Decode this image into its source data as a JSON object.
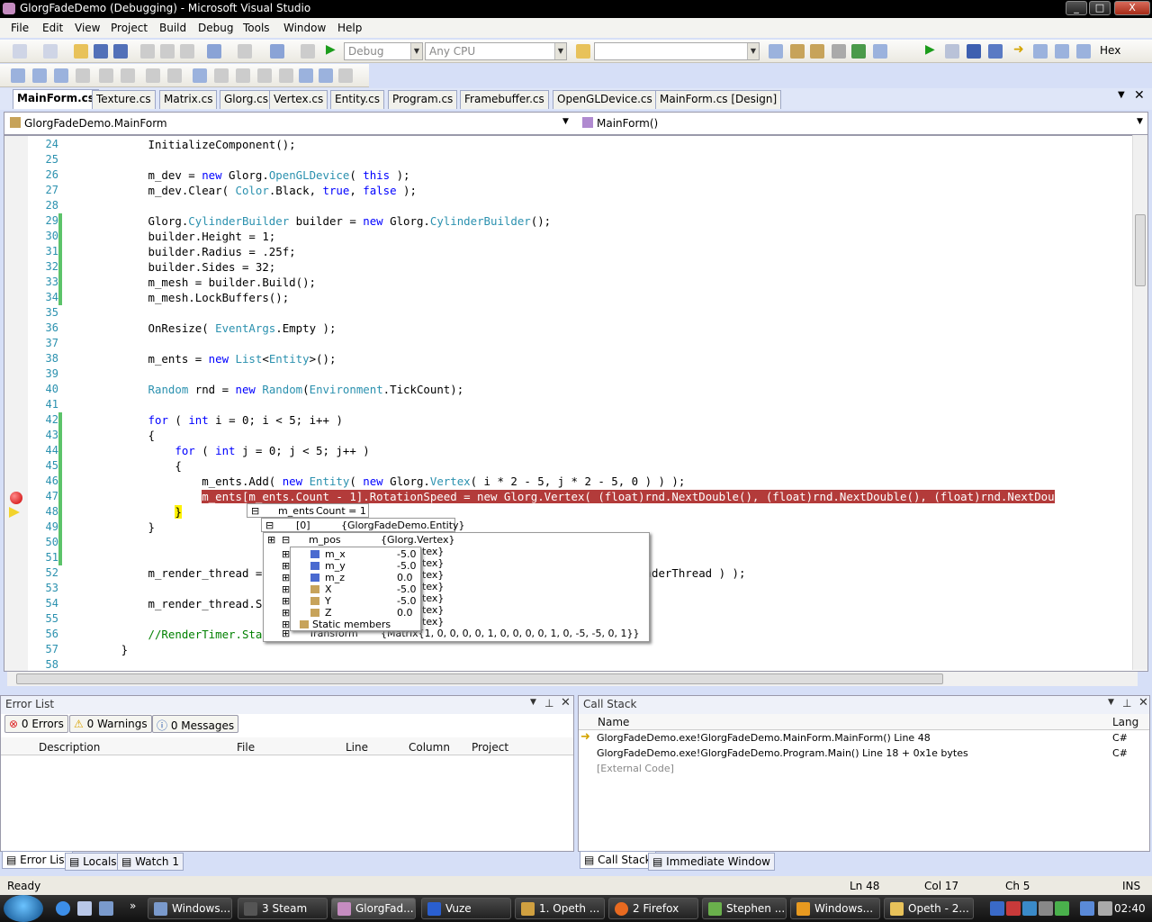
{
  "window": {
    "title": "GlorgFadeDemo (Debugging) - Microsoft Visual Studio",
    "minimize": "_",
    "maximize": "□",
    "close": "X"
  },
  "menu": [
    "File",
    "Edit",
    "View",
    "Project",
    "Build",
    "Debug",
    "Tools",
    "Window",
    "Help"
  ],
  "toolbar": {
    "config": "Debug",
    "platform": "Any CPU",
    "hex": "Hex"
  },
  "tabs": [
    "MainForm.cs",
    "Texture.cs",
    "Matrix.cs",
    "Glorg.cs",
    "Vertex.cs",
    "Entity.cs",
    "Program.cs",
    "Framebuffer.cs",
    "OpenGLDevice.cs",
    "MainForm.cs [Design]"
  ],
  "nav": {
    "class": "GlorgFadeDemo.MainForm",
    "member": "MainForm()"
  },
  "code": [
    {
      "n": "24",
      "t": "            InitializeComponent();"
    },
    {
      "n": "25",
      "t": ""
    },
    {
      "n": "26",
      "t": "            m_dev = new Glorg.OpenGLDevice( this );"
    },
    {
      "n": "27",
      "t": "            m_dev.Clear( Color.Black, true, false );"
    },
    {
      "n": "28",
      "t": ""
    },
    {
      "n": "29",
      "t": "            Glorg.CylinderBuilder builder = new Glorg.CylinderBuilder();"
    },
    {
      "n": "30",
      "t": "            builder.Height = 1;"
    },
    {
      "n": "31",
      "t": "            builder.Radius = .25f;"
    },
    {
      "n": "32",
      "t": "            builder.Sides = 32;"
    },
    {
      "n": "33",
      "t": "            m_mesh = builder.Build();"
    },
    {
      "n": "34",
      "t": "            m_mesh.LockBuffers();"
    },
    {
      "n": "35",
      "t": ""
    },
    {
      "n": "36",
      "t": "            OnResize( EventArgs.Empty );"
    },
    {
      "n": "37",
      "t": ""
    },
    {
      "n": "38",
      "t": "            m_ents = new List<Entity>();"
    },
    {
      "n": "39",
      "t": ""
    },
    {
      "n": "40",
      "t": "            Random rnd = new Random(Environment.TickCount);"
    },
    {
      "n": "41",
      "t": ""
    },
    {
      "n": "42",
      "t": "            for ( int i = 0; i < 5; i++ )"
    },
    {
      "n": "43",
      "t": "            {"
    },
    {
      "n": "44",
      "t": "                for ( int j = 0; j < 5; j++ )"
    },
    {
      "n": "45",
      "t": "                {"
    },
    {
      "n": "46",
      "t": "                    m_ents.Add( new Entity( new Glorg.Vertex( i * 2 - 5, j * 2 - 5, 0 ) ) );"
    },
    {
      "n": "47",
      "t": "                    m_ents[m_ents.Count - 1].RotationSpeed = new Glorg.Vertex( (float)rnd.NextDouble(), (float)rnd.NextDouble(), (float)rnd.NextDou"
    },
    {
      "n": "48",
      "t": "                }"
    },
    {
      "n": "49",
      "t": "            }"
    },
    {
      "n": "50",
      "t": ""
    },
    {
      "n": "51",
      "t": ""
    },
    {
      "n": "52",
      "t": "            m_render_thread =                                          ThreadStart( RenderThread ) );"
    },
    {
      "n": "53",
      "t": ""
    },
    {
      "n": "54",
      "t": "            m_render_thread.S"
    },
    {
      "n": "55",
      "t": ""
    },
    {
      "n": "56",
      "t": "            //RenderTimer.Sta"
    },
    {
      "n": "57",
      "t": "        }"
    },
    {
      "n": "58",
      "t": ""
    }
  ],
  "datatip": {
    "root": {
      "name": "m_ents",
      "value": "Count = 1"
    },
    "item": {
      "name": "[0]",
      "value": "{GlorgFadeDemo.Entity}"
    },
    "pos": {
      "name": "m_pos",
      "value": "{Glorg.Vertex}"
    },
    "fields": [
      {
        "name": "m_x",
        "value": "-5.0"
      },
      {
        "name": "m_y",
        "value": "-5.0"
      },
      {
        "name": "m_z",
        "value": "0.0"
      },
      {
        "name": "X",
        "value": "-5.0"
      },
      {
        "name": "Y",
        "value": "-5.0"
      },
      {
        "name": "Z",
        "value": "0.0"
      },
      {
        "name": "Static members",
        "value": ""
      }
    ],
    "hidden_vals": [
      "tex}",
      "tex}",
      "tex}",
      "tex}",
      "tex}",
      "tex}",
      "tex}"
    ],
    "transform": {
      "name": "Transform",
      "value": "{Matrix{1, 0, 0, 0, 0, 1, 0, 0, 0, 0, 1, 0, -5, -5, 0, 1}}"
    }
  },
  "errorlist": {
    "title": "Error List",
    "errors": "0 Errors",
    "warnings": "0 Warnings",
    "messages": "0 Messages",
    "cols": [
      "Description",
      "File",
      "Line",
      "Column",
      "Project"
    ]
  },
  "callstack": {
    "title": "Call Stack",
    "cols": [
      "Name",
      "Lang"
    ],
    "rows": [
      {
        "name": "GlorgFadeDemo.exe!GlorgFadeDemo.MainForm.MainForm() Line 48",
        "lang": "C#"
      },
      {
        "name": "GlorgFadeDemo.exe!GlorgFadeDemo.Program.Main() Line 18 + 0x1e bytes",
        "lang": "C#"
      },
      {
        "name": "[External Code]",
        "lang": ""
      }
    ]
  },
  "bottom_tabs_left": [
    "Error List",
    "Locals",
    "Watch 1"
  ],
  "bottom_tabs_right": [
    "Call Stack",
    "Immediate Window"
  ],
  "status": {
    "text": "Ready",
    "ln": "Ln 48",
    "col": "Col 17",
    "ch": "Ch 5",
    "mode": "INS"
  },
  "taskbar": {
    "items": [
      "Windows...",
      "3 Steam",
      "GlorgFad...",
      "Vuze",
      "1. Opeth ...",
      "2 Firefox",
      "Stephen ...",
      "Windows...",
      "Opeth - 2..."
    ],
    "clock": "02:40"
  }
}
